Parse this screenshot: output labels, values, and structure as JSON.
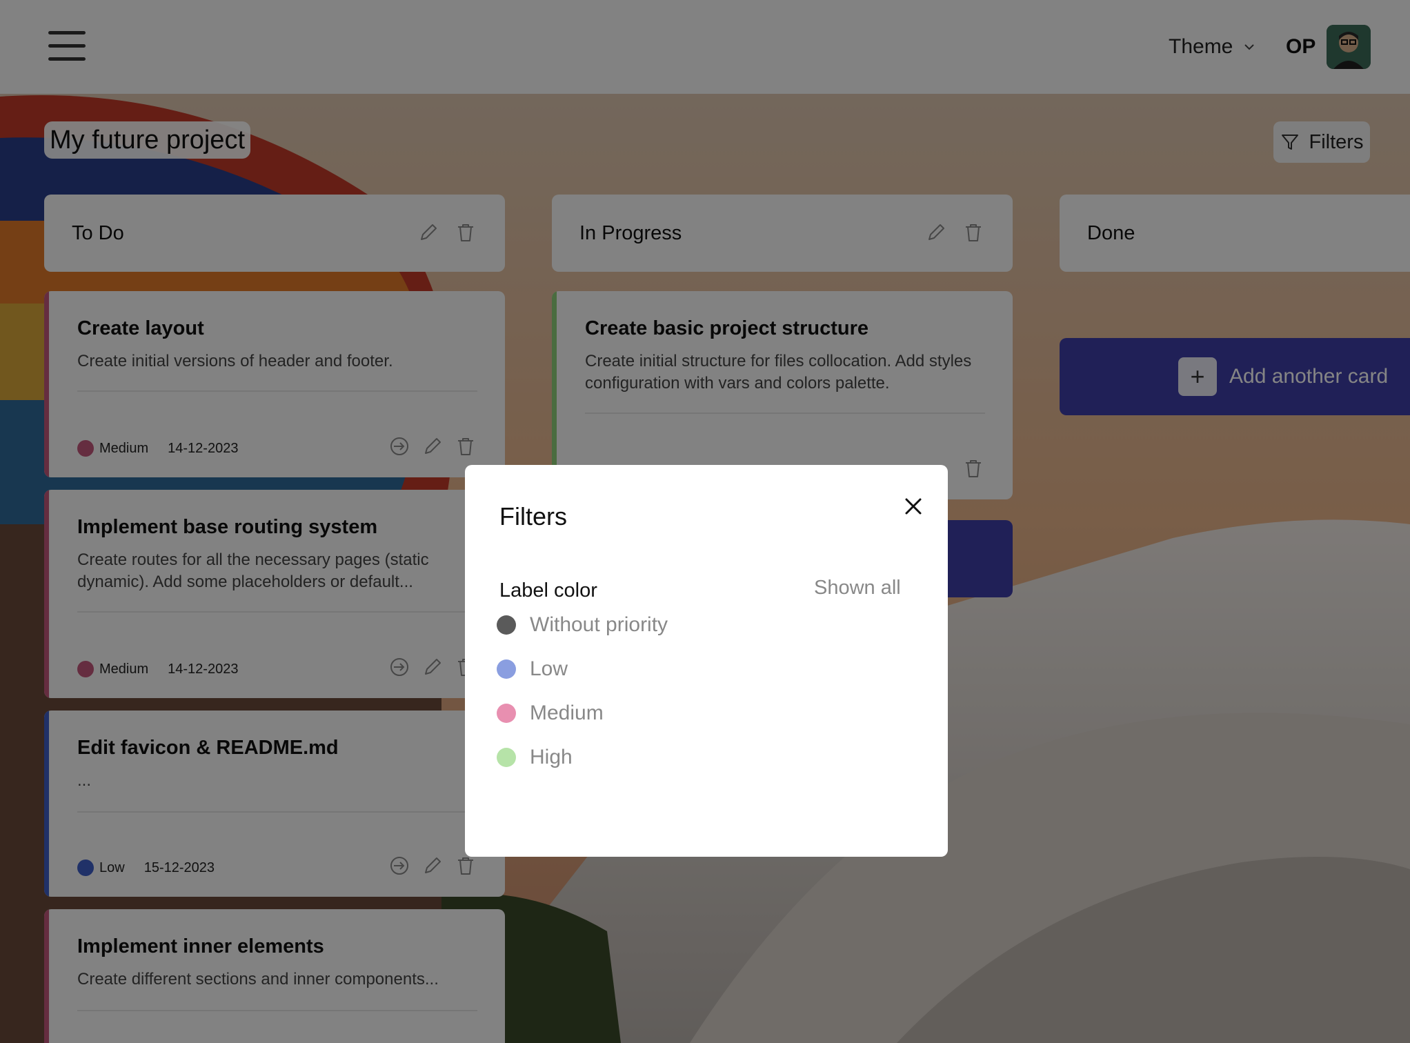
{
  "header": {
    "theme_label": "Theme",
    "user_initials": "OP"
  },
  "project": {
    "title": "My future project",
    "filters_label": "Filters"
  },
  "columns": [
    {
      "title": "To Do",
      "cards": [
        {
          "title": "Create layout",
          "description": "Create initial versions of header and footer.",
          "priority": "Medium",
          "date": "14-12-2023"
        },
        {
          "title": "Implement base routing system",
          "description": "Create routes for all the necessary pages (static dynamic). Add some placeholders or default...",
          "priority": "Medium",
          "date": "14-12-2023"
        },
        {
          "title": "Edit favicon & README.md",
          "description": "...",
          "priority": "Low",
          "date": "15-12-2023"
        },
        {
          "title": "Implement inner elements",
          "description": "Create different sections and inner components..."
        }
      ]
    },
    {
      "title": "In Progress",
      "cards": [
        {
          "title": "Create basic project structure",
          "description": "Create initial structure for files collocation. Add styles configuration with vars and colors palette."
        }
      ]
    },
    {
      "title": "Done",
      "add_card_label": "Add another card"
    }
  ],
  "modal": {
    "title": "Filters",
    "section_label": "Label color",
    "shown_all": "Shown all",
    "options": [
      {
        "label": "Without priority",
        "color": "#5a5a5a"
      },
      {
        "label": "Low",
        "color": "#8a9ee0"
      },
      {
        "label": "Medium",
        "color": "#e88fb0"
      },
      {
        "label": "High",
        "color": "#b6e3a8"
      }
    ]
  },
  "colors": {
    "accent": "#3f3ea8",
    "medium": "#c2577c",
    "low": "#3f5fc8",
    "high": "#8fcf7a"
  }
}
